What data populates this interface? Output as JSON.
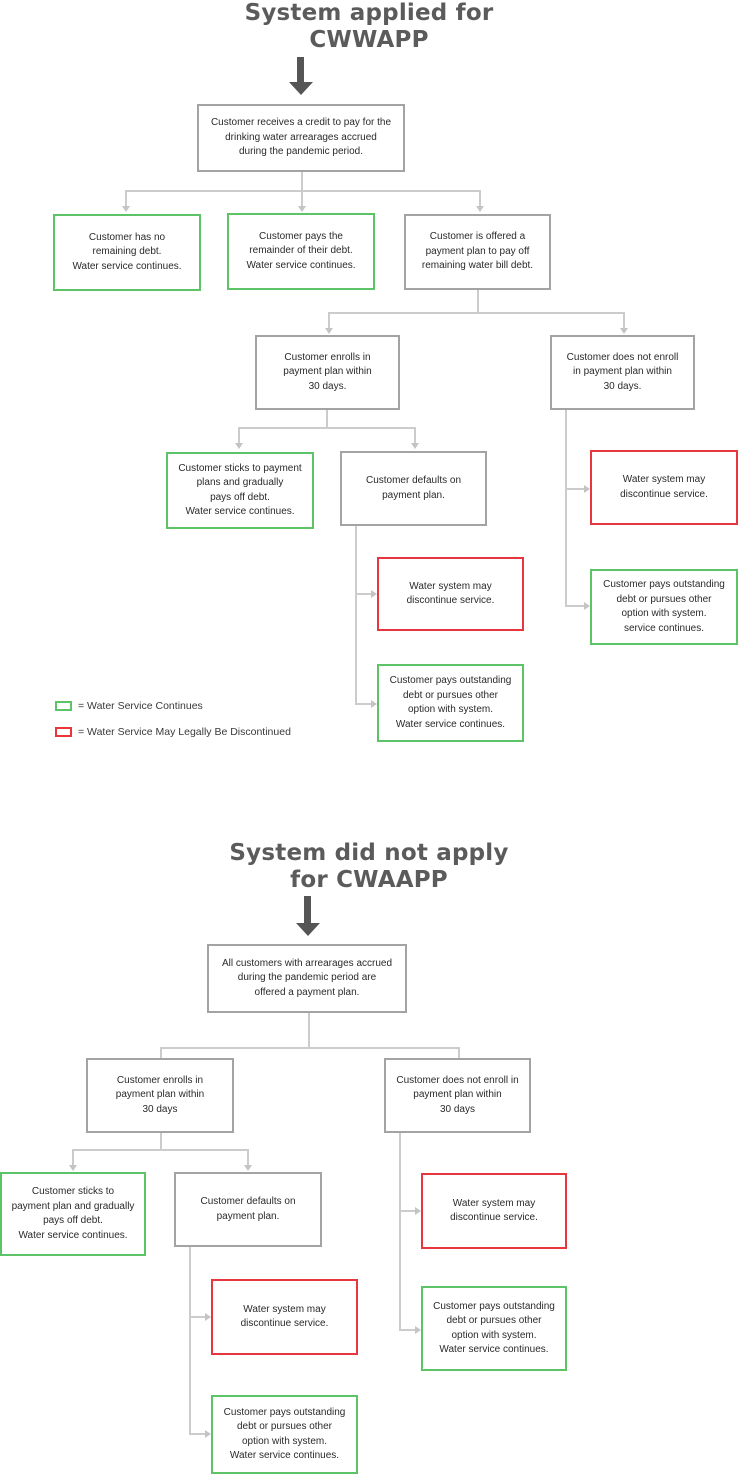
{
  "section1": {
    "title_line1": "System applied for",
    "title_line2": "CWWAPP",
    "root": "Customer receives a credit to pay for the\ndrinking water arrearages accrued\nduring the pandemic period.",
    "no_debt": "Customer has no\nremaining debt.\nWater service continues.",
    "pays_remainder": "Customer pays the\nremainder of their debt.\nWater service continues.",
    "offered_plan": "Customer is offered a\npayment plan to pay off\nremaining water bill debt.",
    "enrolls": "Customer enrolls in\npayment plan within\n30 days.",
    "not_enroll": "Customer does not enroll\nin payment plan within\n30 days.",
    "sticks": "Customer sticks to payment\nplans and gradually\npays off debt.\nWater service continues.",
    "defaults": "Customer defaults on\npayment plan.",
    "defaults_discontinue": "Water system may\ndiscontinue service.",
    "defaults_pays": "Customer pays outstanding\ndebt or pursues other\noption with system.\nWater service continues.",
    "not_enroll_discontinue": "Water system may\ndiscontinue service.",
    "not_enroll_pays": "Customer pays outstanding\ndebt or pursues other\noption with system.\nservice continues."
  },
  "legend": {
    "green_label": "= Water Service Continues",
    "red_label": "= Water Service May Legally Be Discontinued",
    "green_color": "#5cc366",
    "red_color": "#e8363f"
  },
  "section2": {
    "title_line1": "System did not apply",
    "title_line2": "for CWAAPP",
    "root": "All customers with arrearages accrued\nduring the pandemic period are\noffered a payment plan.",
    "enrolls": "Customer enrolls in\npayment plan within\n30 days",
    "not_enroll": "Customer does not enroll in\npayment plan within\n30 days",
    "sticks": "Customer sticks to\npayment plan and gradually\npays off debt.\nWater service continues.",
    "defaults": "Customer defaults on\npayment plan.",
    "defaults_discontinue": "Water system may\ndiscontinue service.",
    "defaults_pays": "Customer pays outstanding\ndebt or pursues other\noption with system.\nWater service continues.",
    "not_enroll_discontinue": "Water system may\ndiscontinue service.",
    "not_enroll_pays": "Customer pays outstanding\ndebt or pursues other\noption with system.\nWater service continues."
  }
}
